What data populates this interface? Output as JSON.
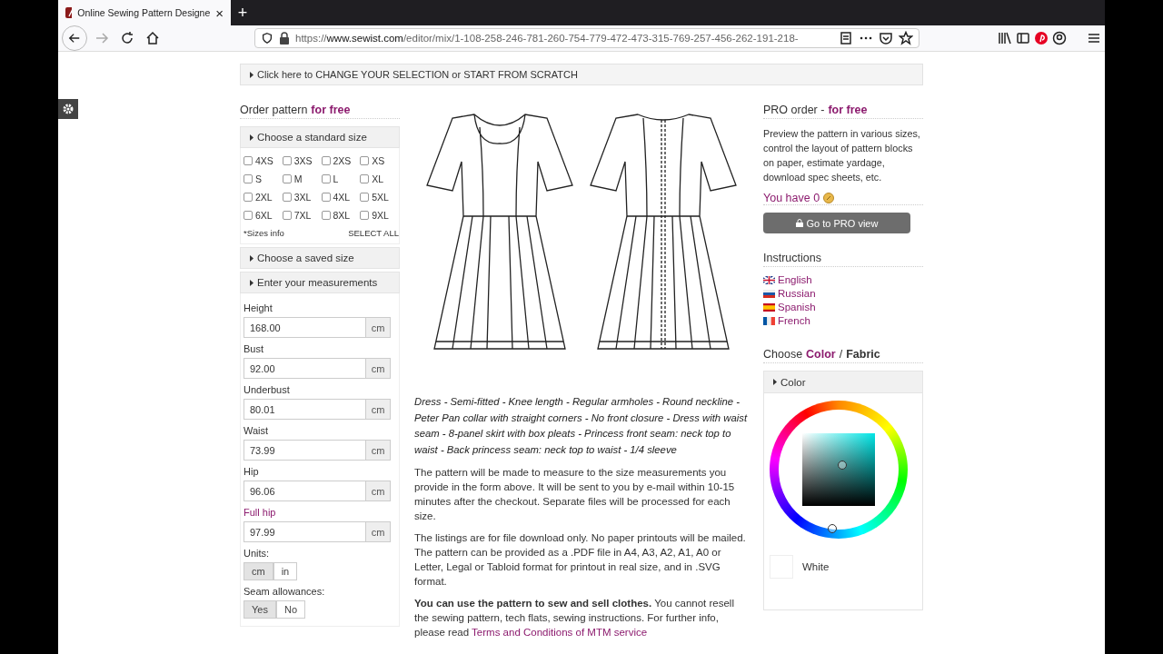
{
  "browser": {
    "tab": {
      "title": "Online Sewing Pattern Designe",
      "close": "×"
    },
    "new_tab": "+",
    "url": {
      "scheme": "https://",
      "host": "www.sewist.com",
      "path": "/editor/mix/1-108-258-246-781-260-754-779-472-473-315-769-257-456-262-191-218-"
    }
  },
  "banner": "Click here to CHANGE YOUR SELECTION or START FROM SCRATCH",
  "order": {
    "title": "Order pattern",
    "accent": "for free",
    "standard_size": {
      "header": "Choose a standard size",
      "sizes": [
        {
          "label": "4XS",
          "checked": false
        },
        {
          "label": "3XS",
          "checked": false
        },
        {
          "label": "2XS",
          "checked": false
        },
        {
          "label": "XS",
          "checked": false
        },
        {
          "label": "S",
          "checked": false
        },
        {
          "label": "M",
          "checked": false
        },
        {
          "label": "L",
          "checked": false
        },
        {
          "label": "XL",
          "checked": false
        },
        {
          "label": "2XL",
          "checked": false
        },
        {
          "label": "3XL",
          "checked": false
        },
        {
          "label": "4XL",
          "checked": false
        },
        {
          "label": "5XL",
          "checked": false
        },
        {
          "label": "6XL",
          "checked": false
        },
        {
          "label": "7XL",
          "checked": false
        },
        {
          "label": "8XL",
          "checked": false
        },
        {
          "label": "9XL",
          "checked": false
        }
      ],
      "sizes_info": "*Sizes info",
      "select_all": "SELECT ALL"
    },
    "saved_size": {
      "header": "Choose a saved size"
    },
    "measurements": {
      "header": "Enter your measurements",
      "fields": [
        {
          "label": "Height",
          "value": "168.00",
          "unit": "cm",
          "highlighted": false
        },
        {
          "label": "Bust",
          "value": "92.00",
          "unit": "cm",
          "highlighted": false
        },
        {
          "label": "Underbust",
          "value": "80.01",
          "unit": "cm",
          "highlighted": false
        },
        {
          "label": "Waist",
          "value": "73.99",
          "unit": "cm",
          "highlighted": false
        },
        {
          "label": "Hip",
          "value": "96.06",
          "unit": "cm",
          "highlighted": false
        },
        {
          "label": "Full hip",
          "value": "97.99",
          "unit": "cm",
          "highlighted": true
        }
      ],
      "units": {
        "label": "Units:",
        "options": [
          {
            "label": "cm",
            "selected": true
          },
          {
            "label": "in",
            "selected": false
          }
        ]
      },
      "seam_allowances": {
        "label": "Seam allowances:",
        "options": [
          {
            "label": "Yes",
            "selected": true
          },
          {
            "label": "No",
            "selected": false
          }
        ]
      }
    }
  },
  "description": "Dress - Semi-fitted - Knee length - Regular armholes - Round neckline - Peter Pan collar with straight corners - No front closure - Dress with waist seam - 8-panel skirt with box pleats - Princess front seam: neck top to waist - Back princess seam: neck top to waist - 1/4 sleeve",
  "paragraphs": [
    "The pattern will be made to measure to the size measurements you provide in the form above. It will be sent to you by e-mail within 10-15 minutes after the checkout. Separate files will be processed for each size.",
    "The listings are for file download only. No paper printouts will be mailed. The pattern can be provided as a .PDF file in A4, A3, A2, A1, A0 or Letter, Legal or Tabloid format for printout in real size, and in .SVG format."
  ],
  "license": {
    "text": "**You can use the pattern to sew and sell clothes.** You cannot resell the sewing pattern, tech flats, sewing instructions. For further info, please read",
    "link": "Terms and Conditions of MTM service"
  },
  "pro": {
    "title": "PRO order -",
    "accent": "for free",
    "text": "Preview the pattern in various sizes, control the layout of pattern blocks on paper, estimate yardage, download spec sheets, etc.",
    "balance": "You have 0",
    "button": "Go to PRO view"
  },
  "instructions": {
    "title": "Instructions",
    "languages": [
      {
        "label": "English",
        "kind": "uk"
      },
      {
        "label": "Russian",
        "kind": "ru"
      },
      {
        "label": "Spanish",
        "kind": "es"
      },
      {
        "label": "French",
        "kind": "fr"
      }
    ]
  },
  "color_fabric": {
    "title": "Choose",
    "color_word": "Color",
    "separator": "/",
    "fabric_word": "Fabric",
    "panel_header": "Color",
    "swatch_label": "White"
  }
}
